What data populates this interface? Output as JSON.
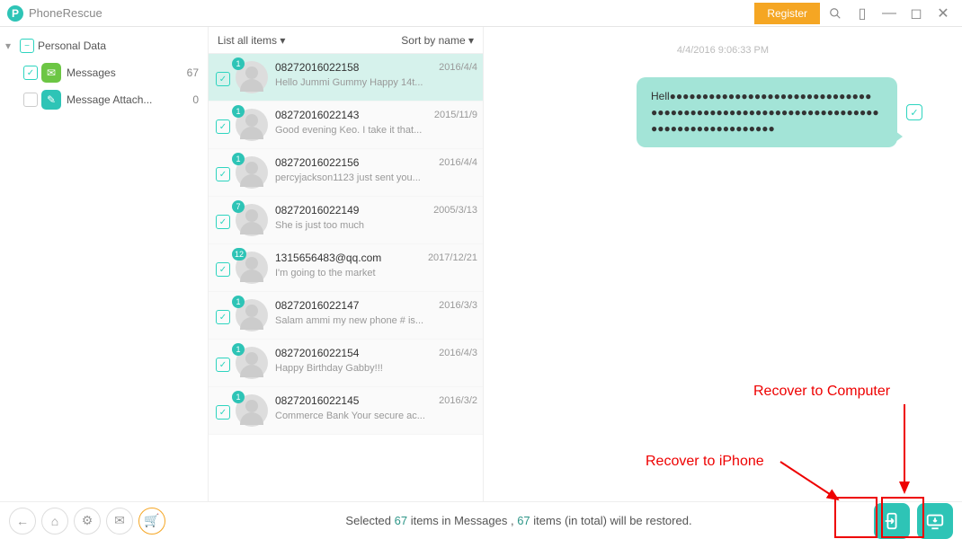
{
  "header": {
    "app_title": "PhoneRescue",
    "register": "Register"
  },
  "sidebar": {
    "root": "Personal Data",
    "items": [
      {
        "label": "Messages",
        "count": "67",
        "icon": "green",
        "checked": true
      },
      {
        "label": "Message Attach...",
        "count": "0",
        "icon": "teal",
        "checked": false
      }
    ]
  },
  "mid": {
    "list_all": "List all items",
    "sort": "Sort by name",
    "messages": [
      {
        "num": "08272016022158",
        "date": "2016/4/4",
        "preview": "Hello Jummi Gummy Happy 14t...",
        "badge": "1",
        "sel": true
      },
      {
        "num": "08272016022143",
        "date": "2015/11/9",
        "preview": "Good evening Keo. I take it that...",
        "badge": "1"
      },
      {
        "num": "08272016022156",
        "date": "2016/4/4",
        "preview": "percyjackson1123 just sent you...",
        "badge": "1"
      },
      {
        "num": "08272016022149",
        "date": "2005/3/13",
        "preview": "She is just too much",
        "badge": "7"
      },
      {
        "num": "1315656483@qq.com",
        "date": "2017/12/21",
        "preview": "I'm going to the market",
        "badge": "12"
      },
      {
        "num": "08272016022147",
        "date": "2016/3/3",
        "preview": "Salam ammi my new phone # is...",
        "badge": "1"
      },
      {
        "num": "08272016022154",
        "date": "2016/4/3",
        "preview": "Happy Birthday Gabby!!!",
        "badge": "1"
      },
      {
        "num": "08272016022145",
        "date": "2016/3/2",
        "preview": "Commerce Bank Your secure ac...",
        "badge": "1"
      }
    ]
  },
  "preview": {
    "date": "4/4/2016 9:06:33 PM",
    "bubble": "Hell●●●●●●●●●●●●●●●●●●●●●●●●●●●●●●● ●●●●●●●●●●●●●●●●●●●●●●●●●●●●●●●●●●● ●●●●●●●●●●●●●●●●●●●"
  },
  "footer": {
    "status_a": "Selected ",
    "count1": "67",
    "status_b": " items in Messages , ",
    "count2": "67",
    "status_c": " items (in total) will be restored."
  },
  "annot": {
    "to_iphone": "Recover to iPhone",
    "to_computer": "Recover to Computer"
  }
}
